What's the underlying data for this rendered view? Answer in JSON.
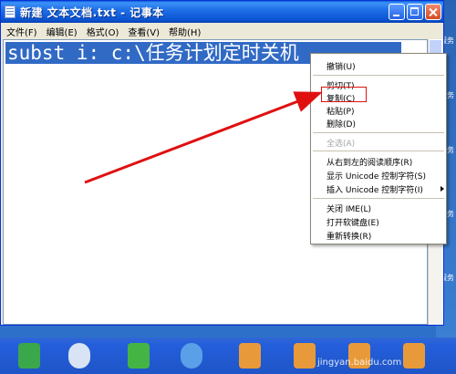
{
  "window": {
    "title": "新建 文本文档.txt - 记事本"
  },
  "menubar": {
    "items": [
      "文件(F)",
      "编辑(E)",
      "格式(O)",
      "查看(V)",
      "帮助(H)"
    ]
  },
  "editor": {
    "content": "subst i: c:\\任务计划定时关机"
  },
  "context_menu": {
    "items": [
      {
        "label": "撤销(U)",
        "enabled": true
      },
      {
        "label": "剪切(T)",
        "enabled": true
      },
      {
        "label": "复制(C)",
        "enabled": true,
        "highlighted": true
      },
      {
        "label": "粘贴(P)",
        "enabled": true
      },
      {
        "label": "删除(D)",
        "enabled": true
      },
      {
        "label": "全选(A)",
        "enabled": false
      },
      {
        "label": "从右到左的阅读顺序(R)",
        "enabled": true
      },
      {
        "label": "显示 Unicode 控制字符(S)",
        "enabled": true
      },
      {
        "label": "插入 Unicode 控制字符(I)",
        "enabled": true,
        "submenu": true
      },
      {
        "label": "关闭 IME(L)",
        "enabled": true
      },
      {
        "label": "打开软键盘(E)",
        "enabled": true
      },
      {
        "label": "重新转换(R)",
        "enabled": true
      }
    ]
  },
  "desktop": {
    "right_labels": [
      "服务",
      "服务",
      "服务",
      "服务",
      "服务"
    ]
  },
  "watermark": "jingyan.baidu.com",
  "colors": {
    "selection": "#316ac5",
    "annotation": "#e01010",
    "titlebar": "#0b53d0"
  }
}
